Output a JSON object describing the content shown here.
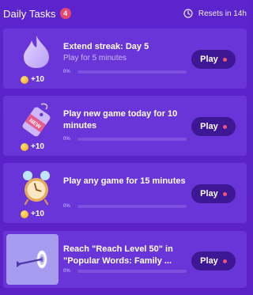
{
  "header": {
    "title": "Daily Tasks",
    "badge_count": "4",
    "reset_text": "Resets in 14h"
  },
  "tasks": [
    {
      "title": "Extend streak: Day 5",
      "subtitle": "Play for 5 minutes",
      "reward": "+10",
      "progress_label": "0%",
      "progress": 0,
      "play_label": "Play",
      "icon": "flame-icon"
    },
    {
      "title": "Play new game today for 10 minutes",
      "subtitle": "",
      "reward": "+10",
      "progress_label": "0%",
      "progress": 0,
      "play_label": "Play",
      "icon": "new-tag-icon"
    },
    {
      "title": "Play any game for 15 minutes",
      "subtitle": "",
      "reward": "+10",
      "progress_label": "0%",
      "progress": 0,
      "play_label": "Play",
      "icon": "alarm-clock-icon"
    },
    {
      "title": "Reach \"Reach Level 50\" in \"Popular Words: Family ...",
      "subtitle": "",
      "reward": "",
      "progress_label": "0%",
      "progress": 0,
      "play_label": "Play",
      "icon": "target-arrow-icon"
    }
  ],
  "colors": {
    "background": "#5a22c8",
    "card": "#6a35d8",
    "play_button": "#3e1794",
    "badge": "#e8466c",
    "accent_dot": "#f0537a"
  }
}
